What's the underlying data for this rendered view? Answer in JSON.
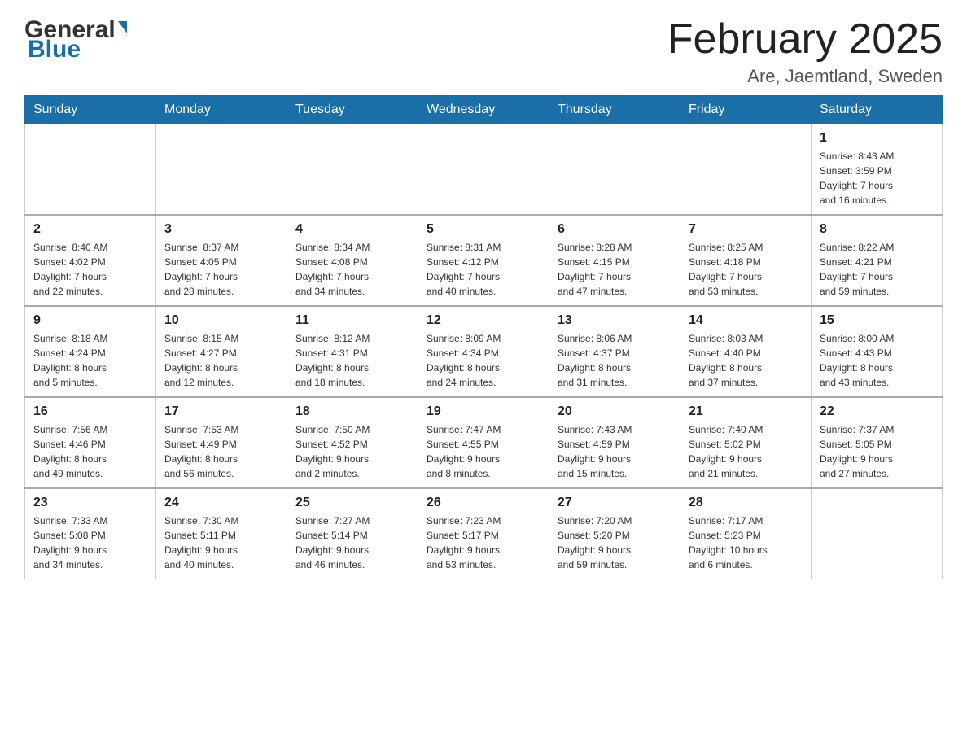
{
  "header": {
    "logo_general": "General",
    "logo_blue": "Blue",
    "month_title": "February 2025",
    "location": "Are, Jaemtland, Sweden"
  },
  "weekdays": [
    "Sunday",
    "Monday",
    "Tuesday",
    "Wednesday",
    "Thursday",
    "Friday",
    "Saturday"
  ],
  "weeks": [
    [
      {
        "day": "",
        "info": ""
      },
      {
        "day": "",
        "info": ""
      },
      {
        "day": "",
        "info": ""
      },
      {
        "day": "",
        "info": ""
      },
      {
        "day": "",
        "info": ""
      },
      {
        "day": "",
        "info": ""
      },
      {
        "day": "1",
        "info": "Sunrise: 8:43 AM\nSunset: 3:59 PM\nDaylight: 7 hours\nand 16 minutes."
      }
    ],
    [
      {
        "day": "2",
        "info": "Sunrise: 8:40 AM\nSunset: 4:02 PM\nDaylight: 7 hours\nand 22 minutes."
      },
      {
        "day": "3",
        "info": "Sunrise: 8:37 AM\nSunset: 4:05 PM\nDaylight: 7 hours\nand 28 minutes."
      },
      {
        "day": "4",
        "info": "Sunrise: 8:34 AM\nSunset: 4:08 PM\nDaylight: 7 hours\nand 34 minutes."
      },
      {
        "day": "5",
        "info": "Sunrise: 8:31 AM\nSunset: 4:12 PM\nDaylight: 7 hours\nand 40 minutes."
      },
      {
        "day": "6",
        "info": "Sunrise: 8:28 AM\nSunset: 4:15 PM\nDaylight: 7 hours\nand 47 minutes."
      },
      {
        "day": "7",
        "info": "Sunrise: 8:25 AM\nSunset: 4:18 PM\nDaylight: 7 hours\nand 53 minutes."
      },
      {
        "day": "8",
        "info": "Sunrise: 8:22 AM\nSunset: 4:21 PM\nDaylight: 7 hours\nand 59 minutes."
      }
    ],
    [
      {
        "day": "9",
        "info": "Sunrise: 8:18 AM\nSunset: 4:24 PM\nDaylight: 8 hours\nand 5 minutes."
      },
      {
        "day": "10",
        "info": "Sunrise: 8:15 AM\nSunset: 4:27 PM\nDaylight: 8 hours\nand 12 minutes."
      },
      {
        "day": "11",
        "info": "Sunrise: 8:12 AM\nSunset: 4:31 PM\nDaylight: 8 hours\nand 18 minutes."
      },
      {
        "day": "12",
        "info": "Sunrise: 8:09 AM\nSunset: 4:34 PM\nDaylight: 8 hours\nand 24 minutes."
      },
      {
        "day": "13",
        "info": "Sunrise: 8:06 AM\nSunset: 4:37 PM\nDaylight: 8 hours\nand 31 minutes."
      },
      {
        "day": "14",
        "info": "Sunrise: 8:03 AM\nSunset: 4:40 PM\nDaylight: 8 hours\nand 37 minutes."
      },
      {
        "day": "15",
        "info": "Sunrise: 8:00 AM\nSunset: 4:43 PM\nDaylight: 8 hours\nand 43 minutes."
      }
    ],
    [
      {
        "day": "16",
        "info": "Sunrise: 7:56 AM\nSunset: 4:46 PM\nDaylight: 8 hours\nand 49 minutes."
      },
      {
        "day": "17",
        "info": "Sunrise: 7:53 AM\nSunset: 4:49 PM\nDaylight: 8 hours\nand 56 minutes."
      },
      {
        "day": "18",
        "info": "Sunrise: 7:50 AM\nSunset: 4:52 PM\nDaylight: 9 hours\nand 2 minutes."
      },
      {
        "day": "19",
        "info": "Sunrise: 7:47 AM\nSunset: 4:55 PM\nDaylight: 9 hours\nand 8 minutes."
      },
      {
        "day": "20",
        "info": "Sunrise: 7:43 AM\nSunset: 4:59 PM\nDaylight: 9 hours\nand 15 minutes."
      },
      {
        "day": "21",
        "info": "Sunrise: 7:40 AM\nSunset: 5:02 PM\nDaylight: 9 hours\nand 21 minutes."
      },
      {
        "day": "22",
        "info": "Sunrise: 7:37 AM\nSunset: 5:05 PM\nDaylight: 9 hours\nand 27 minutes."
      }
    ],
    [
      {
        "day": "23",
        "info": "Sunrise: 7:33 AM\nSunset: 5:08 PM\nDaylight: 9 hours\nand 34 minutes."
      },
      {
        "day": "24",
        "info": "Sunrise: 7:30 AM\nSunset: 5:11 PM\nDaylight: 9 hours\nand 40 minutes."
      },
      {
        "day": "25",
        "info": "Sunrise: 7:27 AM\nSunset: 5:14 PM\nDaylight: 9 hours\nand 46 minutes."
      },
      {
        "day": "26",
        "info": "Sunrise: 7:23 AM\nSunset: 5:17 PM\nDaylight: 9 hours\nand 53 minutes."
      },
      {
        "day": "27",
        "info": "Sunrise: 7:20 AM\nSunset: 5:20 PM\nDaylight: 9 hours\nand 59 minutes."
      },
      {
        "day": "28",
        "info": "Sunrise: 7:17 AM\nSunset: 5:23 PM\nDaylight: 10 hours\nand 6 minutes."
      },
      {
        "day": "",
        "info": ""
      }
    ]
  ]
}
